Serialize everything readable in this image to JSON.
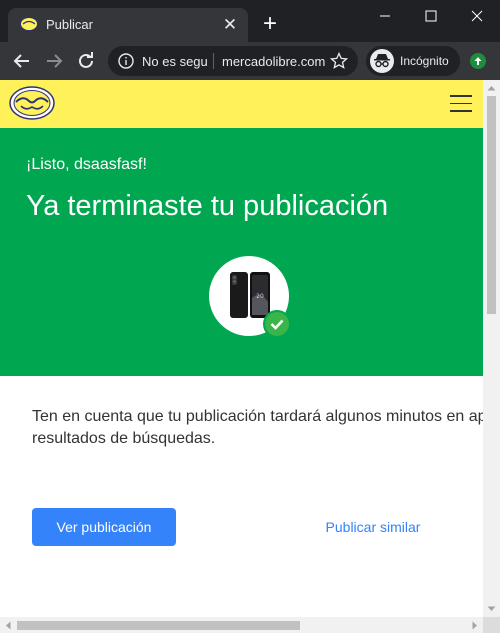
{
  "browser": {
    "tab_title": "Publicar",
    "tab_close_glyph": "✕",
    "new_tab_glyph": "+",
    "security_label": "No es seguro",
    "url": "mercadolibre.com",
    "incognito_label": "Incógnito"
  },
  "page": {
    "greeting": "¡Listo, dsaasfasf!",
    "title": "Ya terminaste tu publicación",
    "notice": "Ten en cuenta que tu publicación tardará algunos minutos en aparecer en los\nresultados de búsquedas.",
    "primary_button": "Ver publicación",
    "secondary_button": "Publicar similar"
  },
  "colors": {
    "brand_yellow": "#fff159",
    "success_green": "#00a650",
    "check_green": "#39b54a",
    "action_blue": "#3483fa"
  },
  "icons": [
    "mercadolibre-logo",
    "info-icon",
    "star-icon",
    "incognito-icon",
    "menu-icon",
    "check-icon",
    "back-arrow-icon",
    "forward-arrow-icon",
    "reload-icon"
  ]
}
